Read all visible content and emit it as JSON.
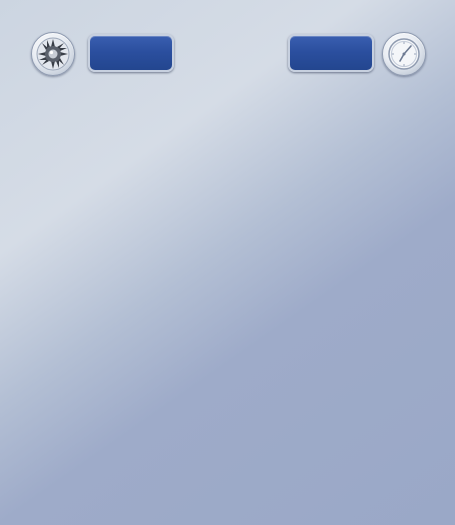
{
  "toolbar": {
    "left_icon": "settings-gear-icon",
    "left_button_label": "",
    "right_button_label": "",
    "right_icon": "clock-icon"
  },
  "colors": {
    "button_blue": "#2b4f9f",
    "background_light": "#d5dce6",
    "background_dark": "#9aa8c7"
  }
}
